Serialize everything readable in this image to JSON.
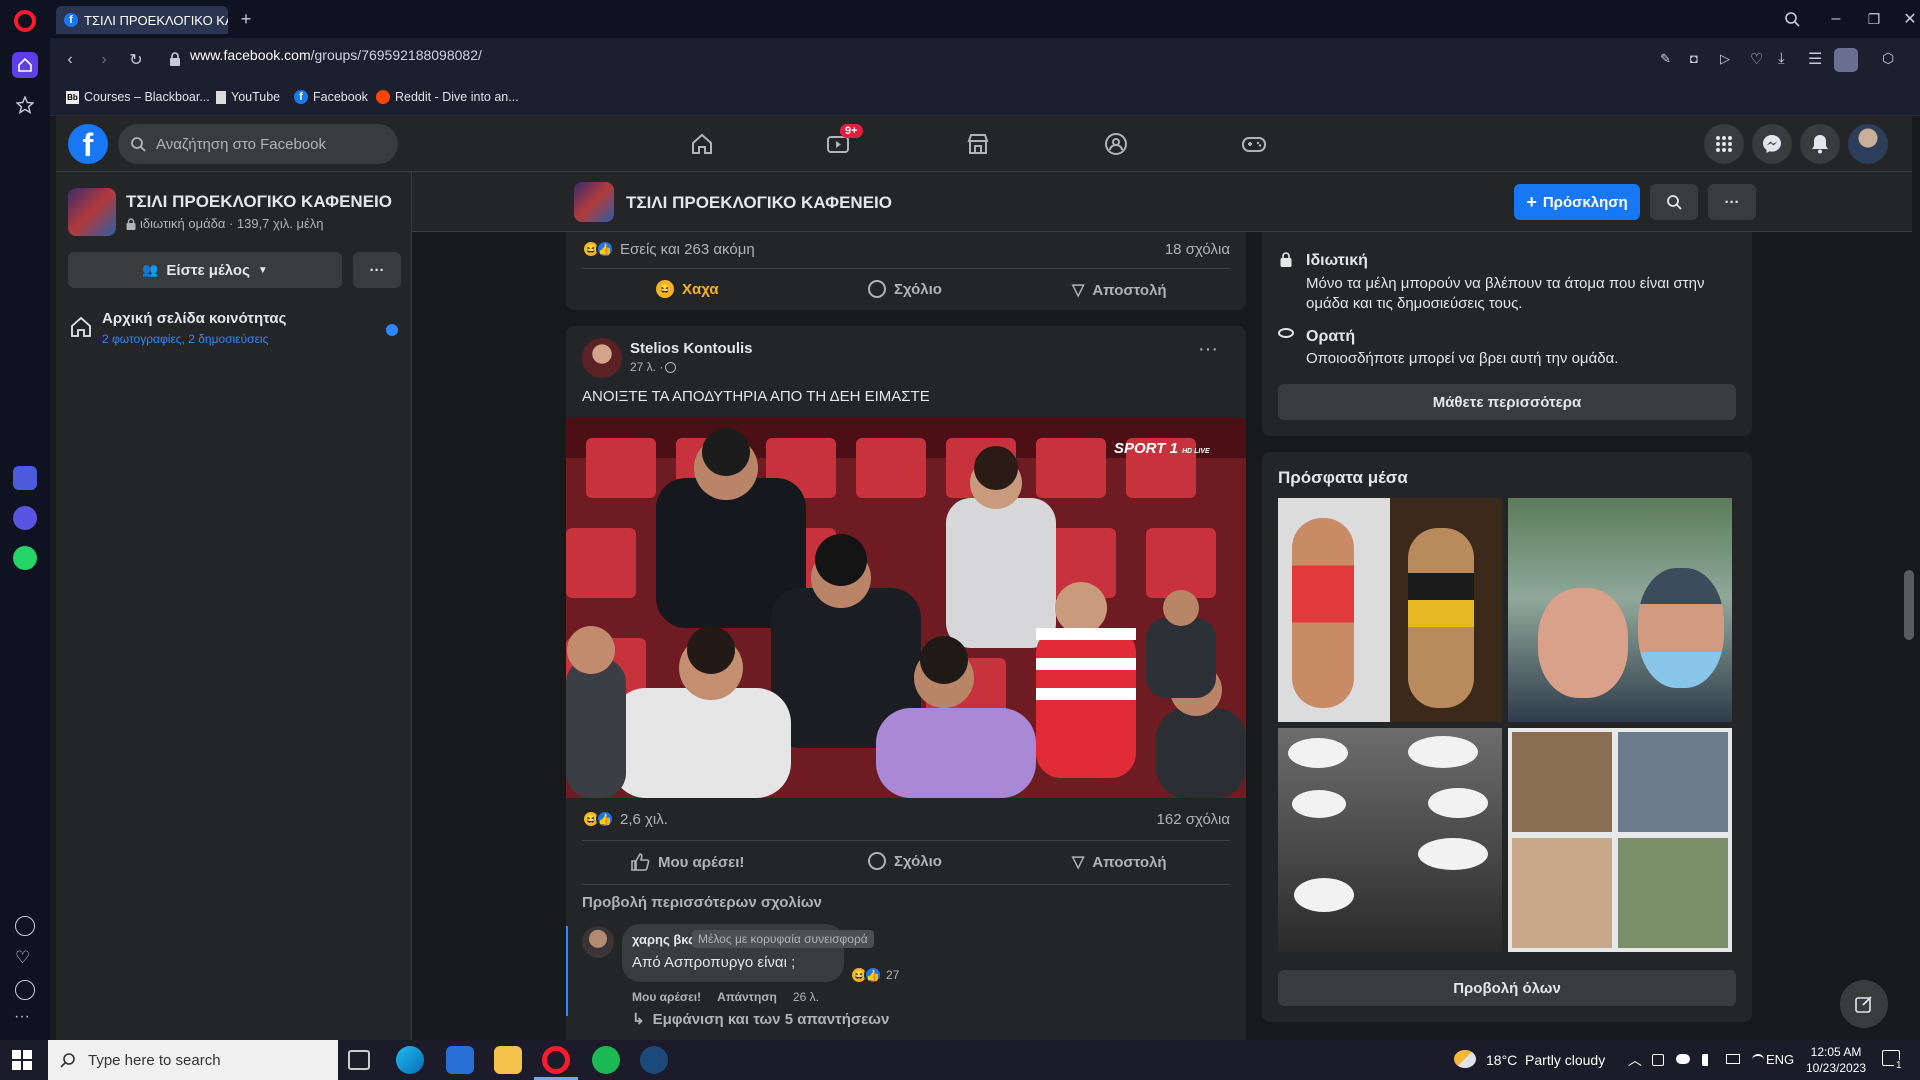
{
  "browser": {
    "tab_title": "ΤΣΙΛΙ ΠΡΟΕΚΛΟΓΙΚΟ ΚΑΦ",
    "url_host": "www.facebook.com",
    "url_path": "/groups/769592188098082/",
    "bookmarks": [
      {
        "label": "Courses – Blackboar..."
      },
      {
        "label": "YouTube"
      },
      {
        "label": "Facebook"
      },
      {
        "label": "Reddit - Dive into an..."
      }
    ]
  },
  "fb_nav": {
    "search_placeholder": "Αναζήτηση στο Facebook",
    "watch_badge": "9+"
  },
  "group": {
    "name": "ΤΣΙΛΙ ΠΡΟΕΚΛΟΓΙΚΟ ΚΑΦΕΝΕΙΟ",
    "meta": "ιδιωτική ομάδα · 139,7 χιλ. μέλη",
    "member_button": "Είστε μέλος",
    "more": "···",
    "community_home_title": "Αρχική σελίδα κοινότητας",
    "community_home_sub": "2 φωτογραφίες, 2 δημοσιεύσεις",
    "invite_button": "Πρόσκληση"
  },
  "post_prev": {
    "reactions_text": "Εσείς και 263 ακόμη",
    "comments_count": "18 σχόλια",
    "action_haha": "Χαχα",
    "action_comment": "Σχόλιο",
    "action_share": "Αποστολή"
  },
  "post": {
    "author": "Stelios Kontoulis",
    "time": "27 λ. · ",
    "text": "ΑΝΟΙΞΤΕ ΤΑ ΑΠΟΔΥΤΗΡΙΑ ΑΠΟ ΤΗ ΔΕΗ ΕΙΜΑΣΤΕ",
    "photo_overlay": "SPORT 1",
    "photo_overlay_sub": "HD LIVE",
    "reactions_count": "2,6 χιλ.",
    "comments_count": "162 σχόλια",
    "action_like": "Μου αρέσει!",
    "action_comment": "Σχόλιο",
    "action_share": "Αποστολή",
    "more_comments": "Προβολή περισσότερων σχολίων",
    "comment": {
      "author": "χαρης βκς",
      "badge": "Μέλος με κορυφαία συνεισφορά",
      "text": "Από Ασπροπυργο είναι ;",
      "like": "Μου αρέσει!",
      "reply": "Απάντηση",
      "time": "26 λ.",
      "reactions": "27",
      "show_replies": "Εμφάνιση και των 5 απαντήσεων"
    }
  },
  "about": {
    "private_title": "Ιδιωτική",
    "private_text": "Μόνο τα μέλη μπορούν να βλέπουν τα άτομα που είναι στην ομάδα και τις δημοσιεύσεις τους.",
    "visible_title": "Ορατή",
    "visible_text": "Οποιοσδήποτε μπορεί να βρει αυτή την ομάδα.",
    "learn_more": "Μάθετε περισσότερα"
  },
  "recent_media": {
    "title": "Πρόσφατα μέσα",
    "see_all": "Προβολή όλων"
  },
  "taskbar": {
    "search": "Type here to search",
    "weather": "18°C  Partly cloudy",
    "lang": "ENG",
    "time": "12:05 AM",
    "date": "10/23/2023",
    "notif": "1"
  },
  "colors": {
    "fb_blue": "#1877f2",
    "haha_yellow": "#f7b125",
    "card_bg": "#242526",
    "page_bg": "#18191a"
  }
}
